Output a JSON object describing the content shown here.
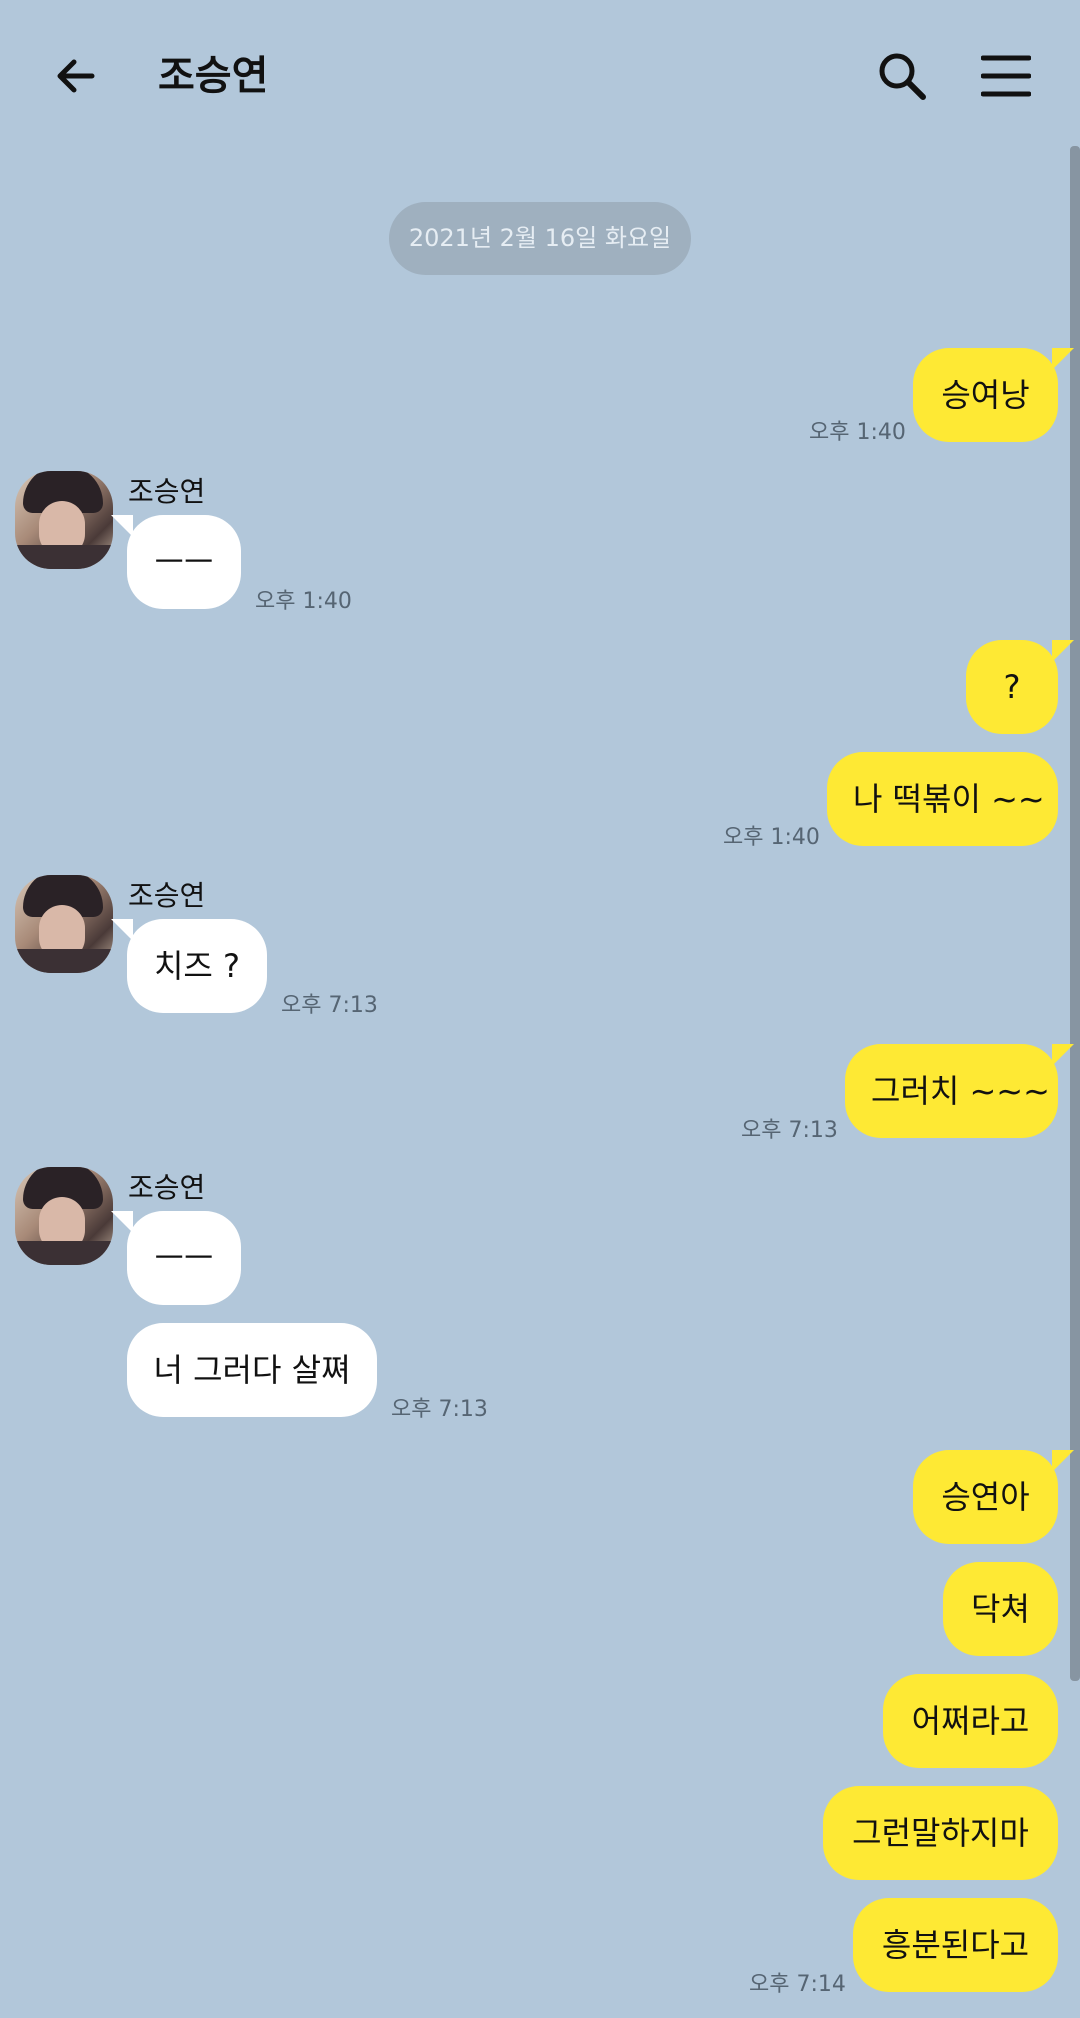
{
  "header": {
    "title": "조승연"
  },
  "date_divider": "2021년 2월 16일 화요일",
  "sender_name": "조승연",
  "messages": {
    "m1": {
      "text": "승여낭",
      "time": "오후 1:40"
    },
    "m2": {
      "text": "ㅡㅡ",
      "time": "오후 1:40"
    },
    "m3": {
      "text": "?"
    },
    "m4": {
      "text": "나 떡볶이 ~~",
      "time": "오후 1:40"
    },
    "m5": {
      "text": "치즈 ?",
      "time": "오후 7:13"
    },
    "m6": {
      "text": "그러치 ~~~",
      "time": "오후 7:13"
    },
    "m7": {
      "text": "ㅡㅡ"
    },
    "m8": {
      "text": "너 그러다 살쪄",
      "time": "오후 7:13"
    },
    "m9": {
      "text": "승연아"
    },
    "m10": {
      "text": "닥쳐"
    },
    "m11": {
      "text": "어쩌라고"
    },
    "m12": {
      "text": "그런말하지마"
    },
    "m13": {
      "text": "흥분된다고",
      "time": "오후 7:14"
    }
  },
  "colors": {
    "background": "#b2c7da",
    "my_bubble": "#fee934",
    "their_bubble": "#ffffff"
  },
  "icons": {
    "back": "arrow-left-icon",
    "search": "search-icon",
    "menu": "hamburger-menu-icon"
  }
}
